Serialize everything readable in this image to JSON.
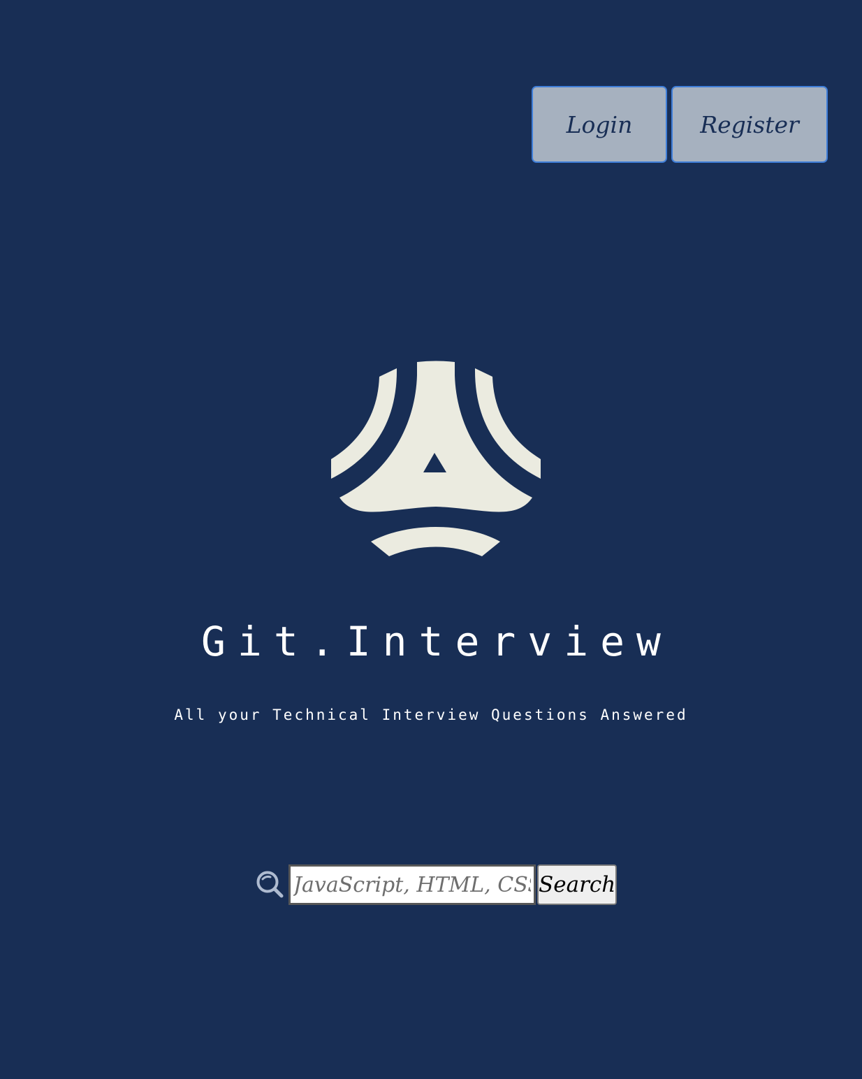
{
  "header": {
    "login_label": "Login",
    "register_label": "Register"
  },
  "brand": {
    "logo_icon": "triangle-sphere-logo-icon",
    "title": "Git.Interview",
    "tagline": "All your Technical Interview Questions Answered"
  },
  "search": {
    "icon": "search-icon",
    "placeholder": "JavaScript, HTML, CSS...",
    "value": "",
    "button_label": "Search"
  },
  "colors": {
    "background": "#182e55",
    "logo": "#ebebe0",
    "auth_button_bg": "#a6b1bf",
    "auth_button_border": "#3f7ed9",
    "search_icon": "#aebbd0"
  }
}
